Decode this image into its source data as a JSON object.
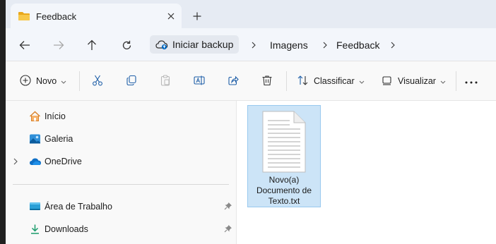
{
  "tab": {
    "title": "Feedback"
  },
  "address": {
    "home": "Iniciar backup",
    "crumbs": [
      "Imagens",
      "Feedback"
    ]
  },
  "commands": {
    "new_label": "Novo",
    "sort_label": "Classificar",
    "view_label": "Visualizar"
  },
  "nav": {
    "items": [
      {
        "label": "Início",
        "icon": "home-icon"
      },
      {
        "label": "Galeria",
        "icon": "gallery-icon"
      },
      {
        "label": "OneDrive",
        "icon": "onedrive-icon"
      },
      {
        "label": "Área de Trabalho",
        "icon": "desktop-icon",
        "pinned": true
      },
      {
        "label": "Downloads",
        "icon": "downloads-icon",
        "pinned": true
      }
    ]
  },
  "files": [
    {
      "name": "Novo(a)\nDocumento de\nTexto.txt",
      "selected": true,
      "icon": "text-document-icon"
    }
  ],
  "colors": {
    "selection": "#cce4f7",
    "selection_border": "#99c9ef",
    "accent": "#0067c0",
    "folder": "#f4c542"
  }
}
